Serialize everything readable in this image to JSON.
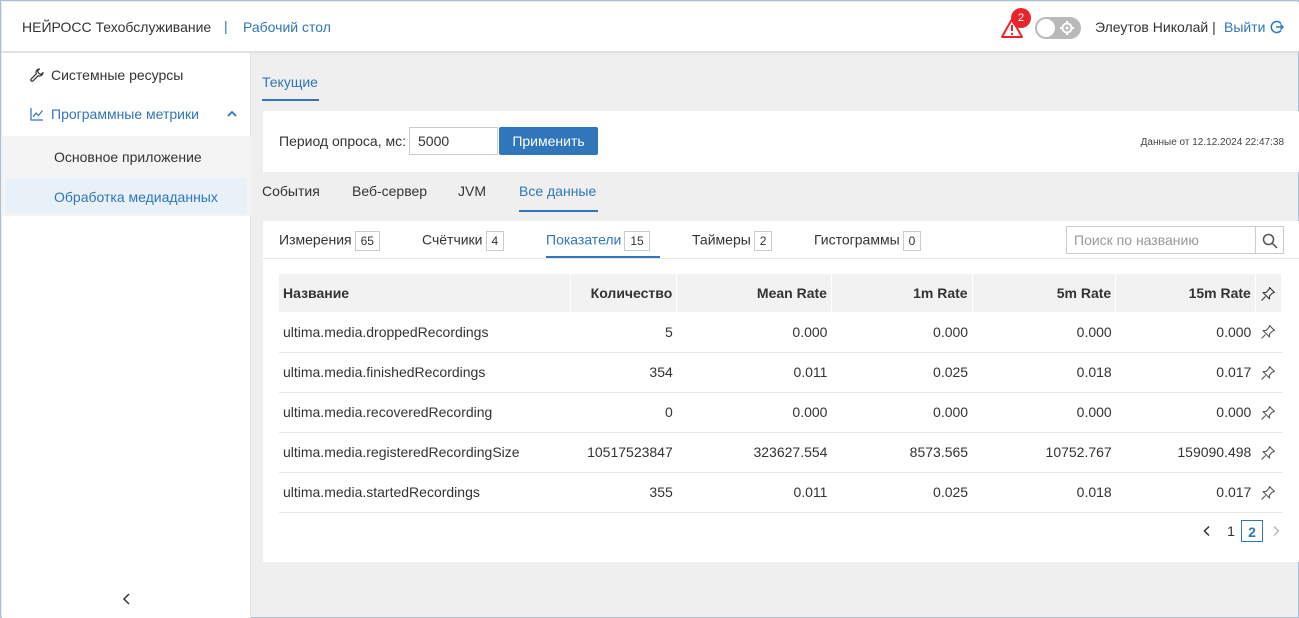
{
  "header": {
    "brand": "НЕЙРОСС Техобслуживание",
    "separator": "|",
    "desk_link": "Рабочий стол",
    "alert_count": "2",
    "user": "Элеутов Николай |",
    "logout": "Выйти"
  },
  "sidebar": {
    "items": [
      {
        "label": "Системные ресурсы",
        "icon": "wrench-icon"
      },
      {
        "label": "Программные метрики",
        "icon": "chart-line-icon"
      }
    ],
    "subitems": [
      {
        "label": "Основное приложение"
      },
      {
        "label": "Обработка медиаданных"
      }
    ]
  },
  "main": {
    "top_tab": "Текущие",
    "poll": {
      "label": "Период опроса, мс:",
      "value": "5000",
      "apply": "Применить",
      "timestamp": "Данные от 12.12.2024 22:47:38"
    },
    "subtabs": [
      "События",
      "Веб-сервер",
      "JVM",
      "Все данные"
    ],
    "ctabs": [
      {
        "label": "Измерения",
        "count": "65"
      },
      {
        "label": "Счётчики",
        "count": "4"
      },
      {
        "label": "Показатели",
        "count": "15"
      },
      {
        "label": "Таймеры",
        "count": "2"
      },
      {
        "label": "Гистограммы",
        "count": "0"
      }
    ],
    "search_placeholder": "Поиск по названию",
    "table": {
      "columns": [
        "Название",
        "Количество",
        "Mean Rate",
        "1m Rate",
        "5m Rate",
        "15m Rate"
      ],
      "rows": [
        [
          "ultima.media.droppedRecordings",
          "5",
          "0.000",
          "0.000",
          "0.000",
          "0.000"
        ],
        [
          "ultima.media.finishedRecordings",
          "354",
          "0.011",
          "0.025",
          "0.018",
          "0.017"
        ],
        [
          "ultima.media.recoveredRecording",
          "0",
          "0.000",
          "0.000",
          "0.000",
          "0.000"
        ],
        [
          "ultima.media.registeredRecordingSize",
          "10517523847",
          "323627.554",
          "8573.565",
          "10752.767",
          "159090.498"
        ],
        [
          "ultima.media.startedRecordings",
          "355",
          "0.011",
          "0.025",
          "0.018",
          "0.017"
        ]
      ]
    },
    "pager": {
      "pages": [
        "1",
        "2"
      ],
      "current": "2"
    }
  },
  "colors": {
    "accent": "#2f76ba",
    "alert": "#e8252b"
  }
}
